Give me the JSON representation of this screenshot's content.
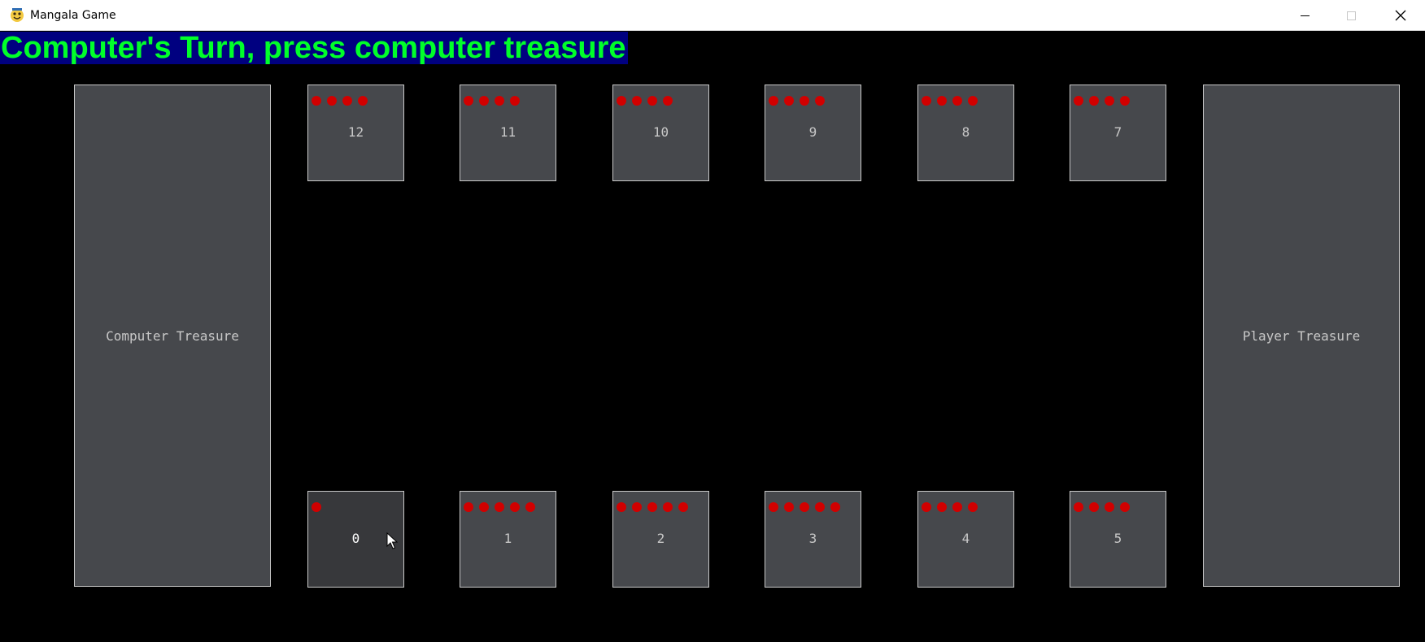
{
  "window": {
    "title": "Mangala Game"
  },
  "status_message": "Computer's Turn, press computer treasure",
  "treasures": {
    "computer": "Computer Treasure",
    "player": "Player Treasure"
  },
  "pits": {
    "top_row": [
      {
        "label": "12",
        "stones": 4
      },
      {
        "label": "11",
        "stones": 4
      },
      {
        "label": "10",
        "stones": 4
      },
      {
        "label": "9",
        "stones": 4
      },
      {
        "label": "8",
        "stones": 4
      },
      {
        "label": "7",
        "stones": 4
      }
    ],
    "bottom_row": [
      {
        "label": "0",
        "stones": 1,
        "hovered": true
      },
      {
        "label": "1",
        "stones": 5
      },
      {
        "label": "2",
        "stones": 5
      },
      {
        "label": "3",
        "stones": 5
      },
      {
        "label": "4",
        "stones": 4
      },
      {
        "label": "5",
        "stones": 4
      }
    ]
  },
  "colors": {
    "banner_text": "#00ff2a",
    "banner_bg": "#000080",
    "stone": "#d10000",
    "pit": "#46484c"
  }
}
